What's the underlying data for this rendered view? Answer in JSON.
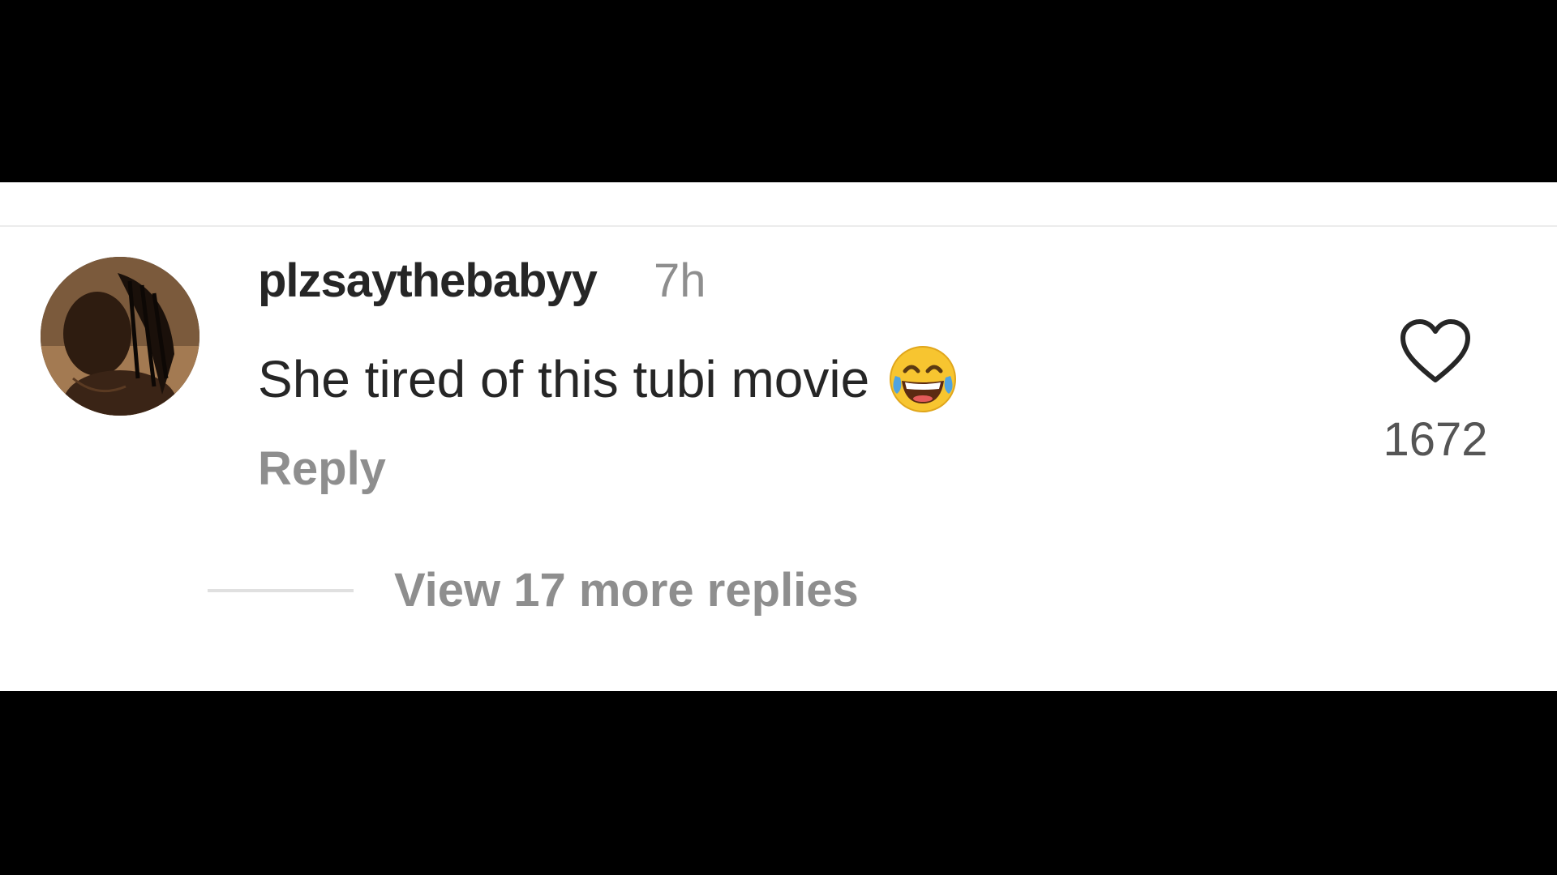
{
  "comment": {
    "username": "plzsaythebabyy",
    "timestamp": "7h",
    "text": "She tired of this tubi movie",
    "emoji": "face-with-tears-of-joy",
    "reply_label": "Reply",
    "like_count": "1672",
    "view_replies_label": "View 17 more replies"
  },
  "icons": {
    "like": "heart-outline-icon",
    "emoji": "face-with-tears-of-joy-icon"
  },
  "colors": {
    "background_letterbox": "#000000",
    "panel": "#ffffff",
    "primary_text": "#262626",
    "secondary_text": "#8e8e8e"
  }
}
